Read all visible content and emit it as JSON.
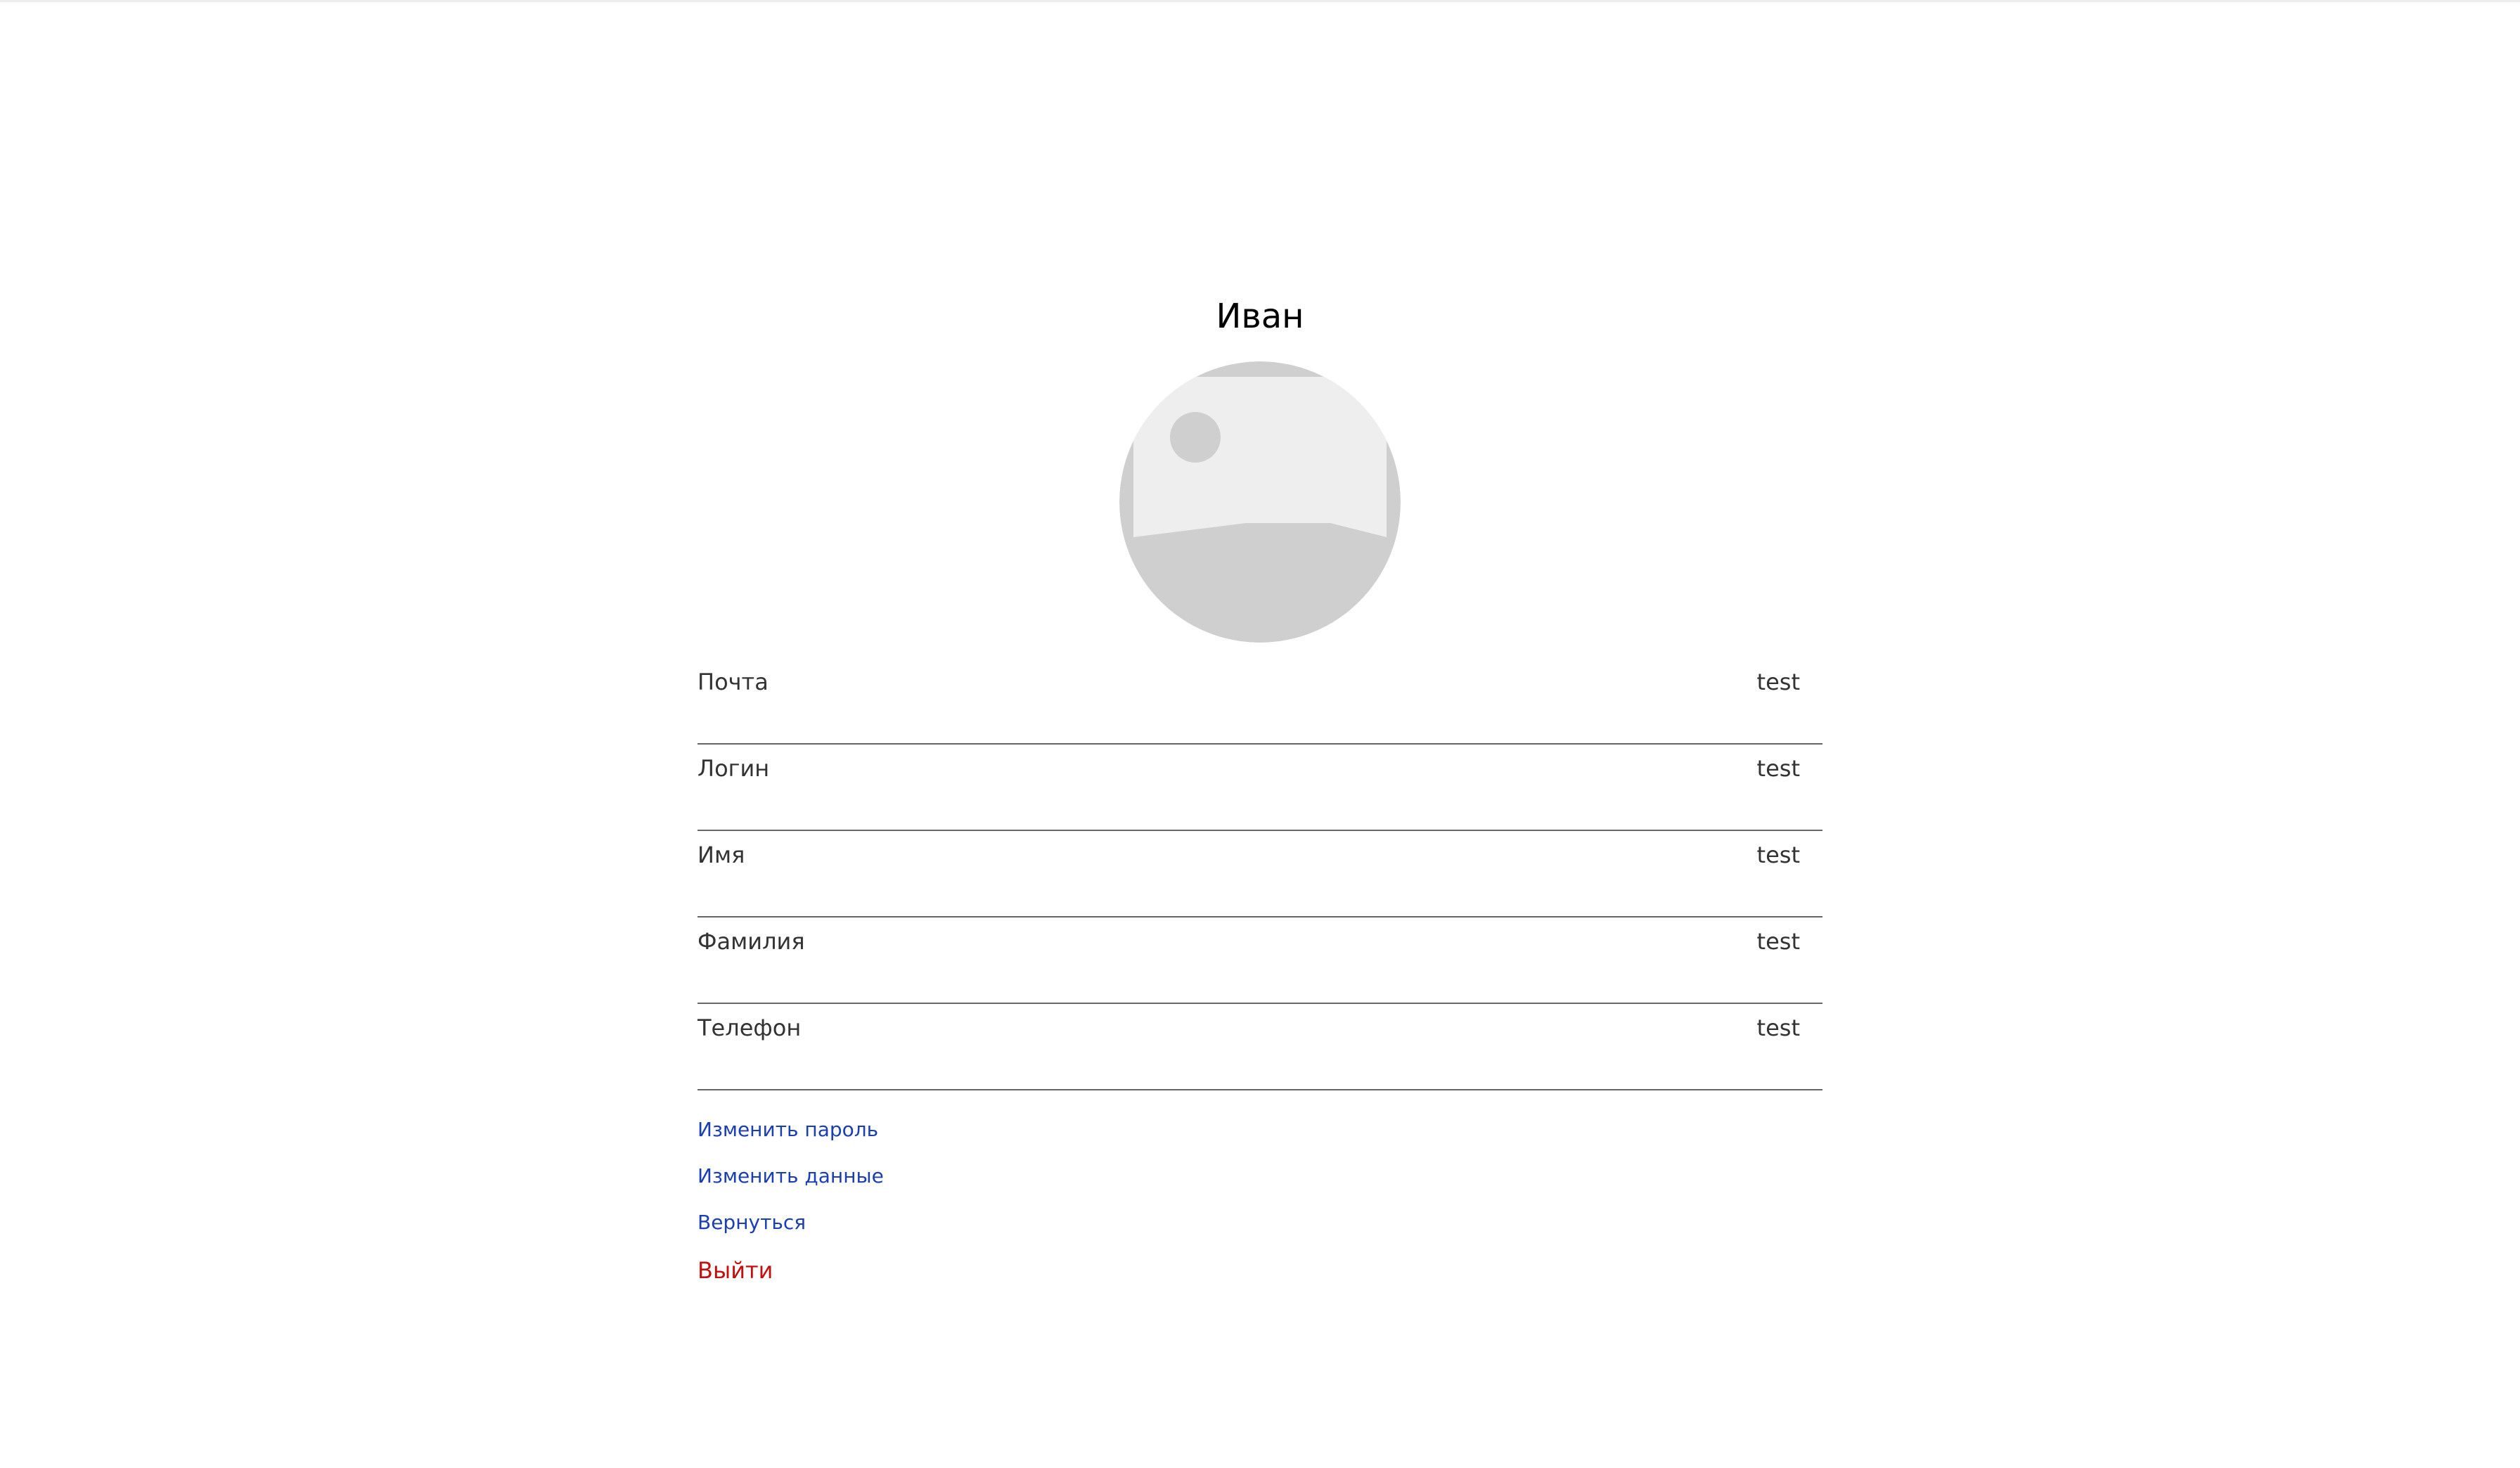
{
  "profile": {
    "display_name": "Иван"
  },
  "fields": [
    {
      "label": "Почта",
      "value": "test"
    },
    {
      "label": "Логин",
      "value": "test"
    },
    {
      "label": "Имя",
      "value": "test"
    },
    {
      "label": "Фамилия",
      "value": "test"
    },
    {
      "label": "Телефон",
      "value": "test"
    }
  ],
  "actions": {
    "change_password": "Изменить пароль",
    "change_data": "Изменить данные",
    "go_back": "Вернуться",
    "logout": "Выйти"
  },
  "colors": {
    "link": "#1a3fb3",
    "logout": "#c40f0f",
    "divider": "#666666",
    "avatar_bg": "#cfcfcf",
    "avatar_fg": "#eeeeee"
  },
  "icons": {
    "avatar": "image-placeholder-icon"
  }
}
